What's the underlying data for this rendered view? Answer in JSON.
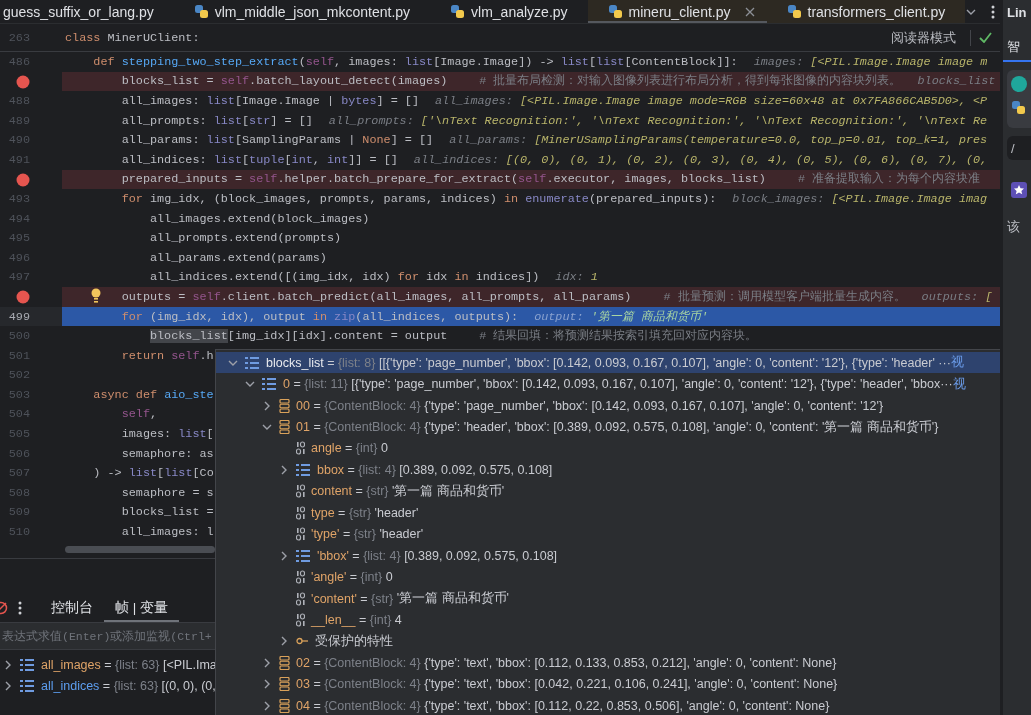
{
  "tabs": [
    {
      "label": "guess_suffix_or_lang.py",
      "icon": false,
      "selected": false,
      "tinted": false
    },
    {
      "label": "vlm_middle_json_mkcontent.py",
      "icon": true,
      "selected": false,
      "tinted": false
    },
    {
      "label": "vlm_analyze.py",
      "icon": true,
      "selected": false,
      "tinted": false
    },
    {
      "label": "mineru_client.py",
      "icon": true,
      "selected": true,
      "tinted": true
    },
    {
      "label": "transformers_client.py",
      "icon": true,
      "selected": false,
      "tinted": true
    }
  ],
  "editor": {
    "sticky": {
      "number": "263",
      "tokens": [
        {
          "kind": "keyword",
          "text": "class "
        },
        {
          "kind": "plain",
          "text": "MinerUClient:"
        }
      ]
    },
    "reader_mode": "阅读器模式",
    "lines": [
      {
        "number": "486",
        "breakpoint": false,
        "current": false,
        "bulb": false,
        "tokens": [
          {
            "kind": "keyword",
            "text": "    def "
          },
          {
            "kind": "function",
            "text": "stepping_two_step_extract"
          },
          {
            "kind": "plain",
            "text": "("
          },
          {
            "kind": "self",
            "text": "self"
          },
          {
            "kind": "plain",
            "text": ", images: "
          },
          {
            "kind": "builtin",
            "text": "list"
          },
          {
            "kind": "plain",
            "text": "[Image.Image]) -> "
          },
          {
            "kind": "builtin",
            "text": "list"
          },
          {
            "kind": "plain",
            "text": "["
          },
          {
            "kind": "builtin",
            "text": "list"
          },
          {
            "kind": "plain",
            "text": "[ContentBlock]]:"
          }
        ],
        "hint": {
          "name": "images:",
          "value": "[<PIL.Image.Image image m"
        }
      },
      {
        "breakpoint": true,
        "current": false,
        "bulb": false,
        "tokens": [
          {
            "kind": "plain",
            "text": "        blocks_list = "
          },
          {
            "kind": "self",
            "text": "self"
          },
          {
            "kind": "plain",
            "text": ".batch_layout_detect(images)"
          }
        ],
        "comment": "# 批量布局检测：对输入图像列表进行布局分析，得到每张图像的内容块列表。",
        "hint": {
          "name": "blocks_list"
        }
      },
      {
        "number": "488",
        "breakpoint": false,
        "current": false,
        "bulb": false,
        "tokens": [
          {
            "kind": "plain",
            "text": "        all_images: "
          },
          {
            "kind": "builtin",
            "text": "list"
          },
          {
            "kind": "plain",
            "text": "[Image.Image | "
          },
          {
            "kind": "builtin",
            "text": "bytes"
          },
          {
            "kind": "plain",
            "text": "] = []"
          }
        ],
        "hint": {
          "name": "all_images:",
          "value": "[<PIL.Image.Image image mode=RGB size=60x48 at 0x7FA866CAB5D0>, <P"
        }
      },
      {
        "number": "489",
        "breakpoint": false,
        "current": false,
        "bulb": false,
        "tokens": [
          {
            "kind": "plain",
            "text": "        all_prompts: "
          },
          {
            "kind": "builtin",
            "text": "list"
          },
          {
            "kind": "plain",
            "text": "["
          },
          {
            "kind": "builtin",
            "text": "str"
          },
          {
            "kind": "plain",
            "text": "] = []"
          }
        ],
        "hint": {
          "name": "all_prompts:",
          "value": "['\\nText Recognition:', '\\nText Recognition:', '\\nText Recognition:', '\\nText Re"
        }
      },
      {
        "number": "490",
        "breakpoint": false,
        "current": false,
        "bulb": false,
        "tokens": [
          {
            "kind": "plain",
            "text": "        all_params: "
          },
          {
            "kind": "builtin",
            "text": "list"
          },
          {
            "kind": "plain",
            "text": "[SamplingParams | "
          },
          {
            "kind": "keyword",
            "text": "None"
          },
          {
            "kind": "plain",
            "text": "] = []"
          }
        ],
        "hint": {
          "name": "all_params:",
          "value": "[MinerUSamplingParams(temperature=0.0, top_p=0.01, top_k=1, pres"
        }
      },
      {
        "number": "491",
        "breakpoint": false,
        "current": false,
        "bulb": false,
        "tokens": [
          {
            "kind": "plain",
            "text": "        all_indices: "
          },
          {
            "kind": "builtin",
            "text": "list"
          },
          {
            "kind": "plain",
            "text": "["
          },
          {
            "kind": "builtin",
            "text": "tuple"
          },
          {
            "kind": "plain",
            "text": "["
          },
          {
            "kind": "builtin",
            "text": "int"
          },
          {
            "kind": "plain",
            "text": ", "
          },
          {
            "kind": "builtin",
            "text": "int"
          },
          {
            "kind": "plain",
            "text": "]] = []"
          }
        ],
        "hint": {
          "name": "all_indices:",
          "value": "[(0, 0), (0, 1), (0, 2), (0, 3), (0, 4), (0, 5), (0, 6), (0, 7), (0,"
        }
      },
      {
        "breakpoint": true,
        "current": false,
        "bulb": false,
        "tokens": [
          {
            "kind": "plain",
            "text": "        prepared_inputs = "
          },
          {
            "kind": "self",
            "text": "self"
          },
          {
            "kind": "plain",
            "text": ".helper.batch_prepare_for_extract("
          },
          {
            "kind": "self",
            "text": "self"
          },
          {
            "kind": "plain",
            "text": ".executor, images, blocks_list)"
          }
        ],
        "comment": "# 准备提取输入：为每个内容块准"
      },
      {
        "number": "493",
        "breakpoint": false,
        "current": false,
        "bulb": false,
        "tokens": [
          {
            "kind": "keyword",
            "text": "        for "
          },
          {
            "kind": "plain",
            "text": "img_idx, (block_images, prompts, params, indices) "
          },
          {
            "kind": "keyword",
            "text": "in "
          },
          {
            "kind": "builtin",
            "text": "enumerate"
          },
          {
            "kind": "plain",
            "text": "(prepared_inputs):"
          }
        ],
        "hint": {
          "name": "block_images:",
          "value": "[<PIL.Image.Image imag"
        }
      },
      {
        "number": "494",
        "breakpoint": false,
        "current": false,
        "bulb": false,
        "tokens": [
          {
            "kind": "plain",
            "text": "            all_images.extend(block_images)"
          }
        ]
      },
      {
        "number": "495",
        "breakpoint": false,
        "current": false,
        "bulb": false,
        "tokens": [
          {
            "kind": "plain",
            "text": "            all_prompts.extend(prompts)"
          }
        ]
      },
      {
        "number": "496",
        "breakpoint": false,
        "current": false,
        "bulb": false,
        "tokens": [
          {
            "kind": "plain",
            "text": "            all_params.extend(params)"
          }
        ]
      },
      {
        "number": "497",
        "breakpoint": false,
        "current": false,
        "bulb": false,
        "tokens": [
          {
            "kind": "plain",
            "text": "            all_indices.extend([(img_idx, idx) "
          },
          {
            "kind": "keyword",
            "text": "for "
          },
          {
            "kind": "plain",
            "text": "idx "
          },
          {
            "kind": "keyword",
            "text": "in "
          },
          {
            "kind": "plain",
            "text": "indices])"
          }
        ],
        "hint": {
          "name": "idx:",
          "value": "1"
        }
      },
      {
        "breakpoint": true,
        "current": false,
        "bulb": true,
        "tokens": [
          {
            "kind": "plain",
            "text": "        outputs = "
          },
          {
            "kind": "self",
            "text": "self"
          },
          {
            "kind": "plain",
            "text": ".client.batch_predict(all_images, all_prompts, all_params)"
          }
        ],
        "comment": "# 批量预测：调用模型客户端批量生成内容。",
        "hint": {
          "name": "outputs:",
          "value": "["
        }
      },
      {
        "number": "499",
        "breakpoint": false,
        "current": true,
        "bulb": false,
        "tokens": [
          {
            "kind": "keyword",
            "text": "        for "
          },
          {
            "kind": "plain",
            "text": "(img_idx, idx), output "
          },
          {
            "kind": "keyword",
            "text": "in "
          },
          {
            "kind": "builtin",
            "text": "zip"
          },
          {
            "kind": "plain",
            "text": "(all_indices, outputs):"
          }
        ],
        "hint": {
          "name": "output:",
          "value": "'第一篇 商品和货币'"
        }
      },
      {
        "number": "500",
        "breakpoint": false,
        "current": false,
        "bulb": false,
        "tokens": [
          {
            "kind": "highlight",
            "text": "            blocks_list"
          },
          {
            "kind": "plain",
            "text": "[img_idx][idx].content = output"
          }
        ],
        "comment": "# 结果回填：将预测结果按索引填充回对应内容块。"
      },
      {
        "number": "501",
        "breakpoint": false,
        "current": false,
        "bulb": false,
        "tokens": [
          {
            "kind": "keyword",
            "text": "        return "
          },
          {
            "kind": "self",
            "text": "self"
          },
          {
            "kind": "plain",
            "text": ".h"
          }
        ]
      },
      {
        "number": "502",
        "breakpoint": false,
        "current": false,
        "bulb": false
      },
      {
        "number": "503",
        "breakpoint": false,
        "current": false,
        "bulb": false,
        "tokens": [
          {
            "kind": "keyword",
            "text": "    async def "
          },
          {
            "kind": "function",
            "text": "aio_ste"
          }
        ]
      },
      {
        "number": "504",
        "breakpoint": false,
        "current": false,
        "bulb": false,
        "tokens": [
          {
            "kind": "self",
            "text": "        self"
          },
          {
            "kind": "plain",
            "text": ","
          }
        ]
      },
      {
        "number": "505",
        "breakpoint": false,
        "current": false,
        "bulb": false,
        "tokens": [
          {
            "kind": "plain",
            "text": "        images: "
          },
          {
            "kind": "builtin",
            "text": "list"
          },
          {
            "kind": "plain",
            "text": "["
          }
        ]
      },
      {
        "number": "506",
        "breakpoint": false,
        "current": false,
        "bulb": false,
        "tokens": [
          {
            "kind": "plain",
            "text": "        semaphore: as"
          }
        ]
      },
      {
        "number": "507",
        "breakpoint": false,
        "current": false,
        "bulb": false,
        "tokens": [
          {
            "kind": "plain",
            "text": "    ) -> "
          },
          {
            "kind": "builtin",
            "text": "list"
          },
          {
            "kind": "plain",
            "text": "["
          },
          {
            "kind": "builtin",
            "text": "list"
          },
          {
            "kind": "plain",
            "text": "[Co"
          }
        ]
      },
      {
        "number": "508",
        "breakpoint": false,
        "current": false,
        "bulb": false,
        "tokens": [
          {
            "kind": "plain",
            "text": "        semaphore = s"
          }
        ]
      },
      {
        "number": "509",
        "breakpoint": false,
        "current": false,
        "bulb": false,
        "tokens": [
          {
            "kind": "plain",
            "text": "        blocks_list ="
          }
        ]
      },
      {
        "number": "510",
        "breakpoint": false,
        "current": false,
        "bulb": false,
        "tokens": [
          {
            "kind": "plain",
            "text": "        all_images: l"
          }
        ]
      }
    ]
  },
  "debug": {
    "tabs": [
      {
        "label": "控制台",
        "selected": false
      },
      {
        "label": "帧 | 变量",
        "selected": true
      }
    ],
    "expression_placeholder": "表达式求值(Enter)或添加监视(Ctrl+",
    "variables": [
      {
        "kind": "list",
        "name": "all_images",
        "assign": "=",
        "type": "{list: 63}",
        "value": "[<PIL.Ima",
        "changed": false,
        "expanded": false
      },
      {
        "kind": "list",
        "name": "all_indices",
        "assign": "=",
        "type": "{list: 63}",
        "value": "[(0, 0), (0,",
        "changed": true,
        "expanded": false
      }
    ]
  },
  "inspector": {
    "tree": [
      {
        "kind": "list",
        "name": "blocks_list",
        "assign": "=",
        "type": "{list: 8}",
        "value": "[[{'type': 'page_number', 'bbox': [0.142, 0.093, 0.167, 0.107], 'angle': 0, 'content': '12'}, {'type': 'header' ···",
        "link": "视",
        "expanded": true,
        "selected": true,
        "children": [
          {
            "kind": "list",
            "name": "0",
            "assign": "=",
            "type": "{list: 11}",
            "value": "[{'type': 'page_number', 'bbox': [0.142, 0.093, 0.167, 0.107], 'angle': 0, 'content': '12'}, {'type': 'header', 'bbox···",
            "link": "视",
            "expanded": true,
            "selected": false,
            "children": [
              {
                "kind": "object",
                "name": "00",
                "assign": "=",
                "type": "{ContentBlock: 4}",
                "value": "{'type': 'page_number', 'bbox': [0.142, 0.093, 0.167, 0.107], 'angle': 0, 'content': '12'}",
                "expanded": false,
                "selected": false
              },
              {
                "kind": "object",
                "name": "01",
                "assign": "=",
                "type": "{ContentBlock: 4}",
                "value": "{'type': 'header', 'bbox': [0.389, 0.092, 0.575, 0.108], 'angle': 0, 'content': '第一篇 商品和货币'}",
                "expanded": true,
                "selected": false,
                "children": [
                  {
                    "kind": "primitive",
                    "name": "angle",
                    "assign": "=",
                    "type": "{int}",
                    "value": "0",
                    "selected": false
                  },
                  {
                    "kind": "list",
                    "name": "bbox",
                    "assign": "=",
                    "type": "{list: 4}",
                    "value": "[0.389, 0.092, 0.575, 0.108]",
                    "expanded": false,
                    "selected": false
                  },
                  {
                    "kind": "primitive",
                    "name": "content",
                    "assign": "=",
                    "type": "{str}",
                    "value": "'第一篇 商品和货币'",
                    "selected": false
                  },
                  {
                    "kind": "primitive",
                    "name": "type",
                    "assign": "=",
                    "type": "{str}",
                    "value": "'header'",
                    "selected": false
                  },
                  {
                    "kind": "primitive",
                    "name": "'type'",
                    "assign": "=",
                    "type": "{str}",
                    "value": "'header'",
                    "selected": false
                  },
                  {
                    "kind": "list",
                    "name": "'bbox'",
                    "assign": "=",
                    "type": "{list: 4}",
                    "value": "[0.389, 0.092, 0.575, 0.108]",
                    "expanded": false,
                    "selected": false
                  },
                  {
                    "kind": "primitive",
                    "name": "'angle'",
                    "assign": "=",
                    "type": "{int}",
                    "value": "0",
                    "selected": false
                  },
                  {
                    "kind": "primitive",
                    "name": "'content'",
                    "assign": "=",
                    "type": "{str}",
                    "value": "'第一篇 商品和货币'",
                    "selected": false
                  },
                  {
                    "kind": "primitive",
                    "name": "__len__",
                    "assign": "=",
                    "type": "{int}",
                    "value": "4",
                    "selected": false
                  },
                  {
                    "kind": "protected",
                    "name": "受保护的特性",
                    "expanded": false,
                    "selected": false
                  }
                ]
              },
              {
                "kind": "object",
                "name": "02",
                "assign": "=",
                "type": "{ContentBlock: 4}",
                "value": "{'type': 'text', 'bbox': [0.112, 0.133, 0.853, 0.212], 'angle': 0, 'content': None}",
                "expanded": false,
                "selected": false
              },
              {
                "kind": "object",
                "name": "03",
                "assign": "=",
                "type": "{ContentBlock: 4}",
                "value": "{'type': 'text', 'bbox': [0.042, 0.221, 0.106, 0.241], 'angle': 0, 'content': None}",
                "expanded": false,
                "selected": false
              },
              {
                "kind": "object",
                "name": "04",
                "assign": "=",
                "type": "{ContentBlock: 4}",
                "value": "{'type': 'text', 'bbox': [0.112, 0.22, 0.853, 0.506], 'angle': 0, 'content': None}",
                "expanded": false,
                "selected": false
              }
            ]
          }
        ]
      }
    ]
  },
  "sidebar": {
    "title": "Lin",
    "tab": "智",
    "path": "/",
    "text": "该"
  }
}
